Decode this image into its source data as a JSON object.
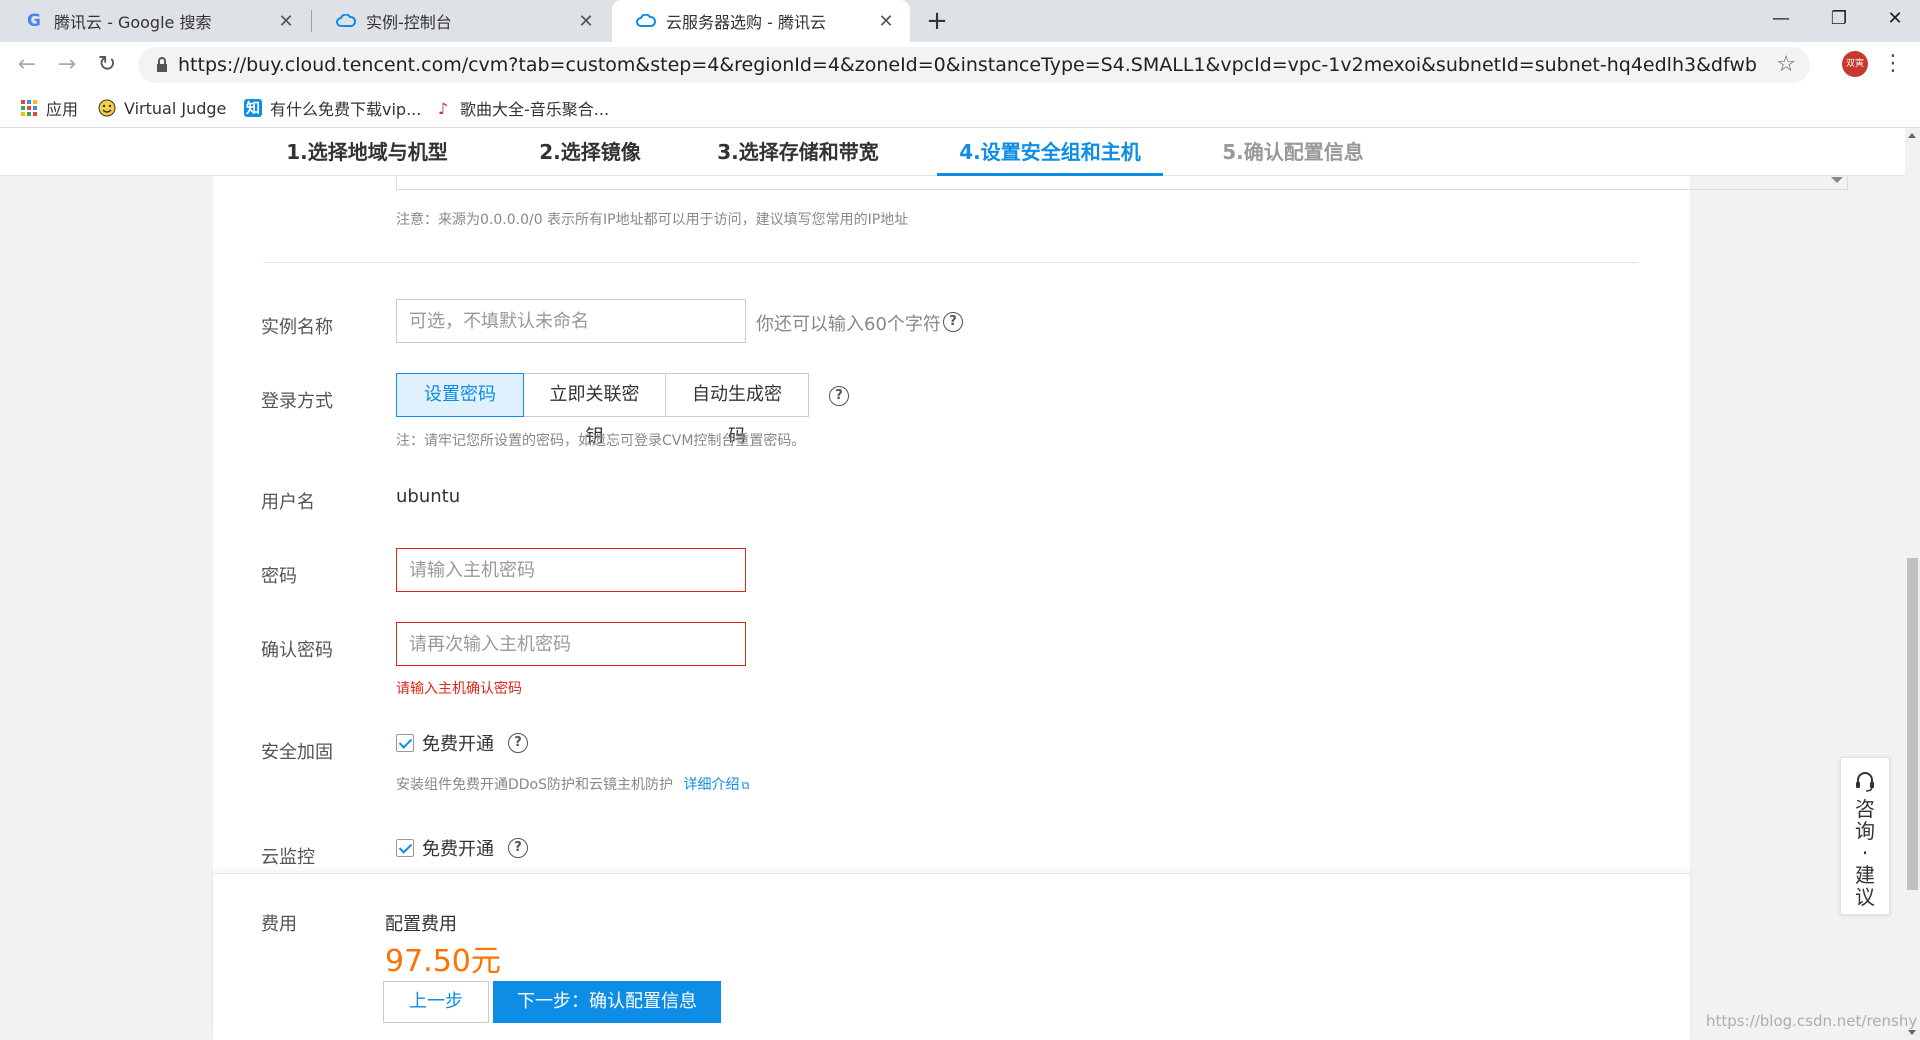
{
  "browser": {
    "tabs": [
      {
        "title": "腾讯云 - Google 搜索",
        "icon": "google-icon"
      },
      {
        "title": "实例-控制台",
        "icon": "cloud-icon"
      },
      {
        "title": "云服务器选购 - 腾讯云",
        "icon": "cloud-icon",
        "active": true
      }
    ],
    "url": "https://buy.cloud.tencent.com/cvm?tab=custom&step=4&regionId=4&zoneId=0&instanceType=S4.SMALL1&vpcId=vpc-1v2mexoi&subnetId=subnet-hq4edlh3&dfwbindType=add&platf...",
    "profile_label": "双寅",
    "bookmarks": [
      {
        "label": "应用",
        "icon": "apps-grid-icon"
      },
      {
        "label": "Virtual Judge",
        "icon": "smiley-icon"
      },
      {
        "label": "有什么免费下载vip...",
        "icon": "zhihu-icon",
        "icon_text": "知"
      },
      {
        "label": "歌曲大全-音乐聚合...",
        "icon": "music-note-icon"
      }
    ]
  },
  "steps": [
    {
      "label": "1.选择地域与机型"
    },
    {
      "label": "2.选择镜像"
    },
    {
      "label": "3.选择存储和带宽"
    },
    {
      "label": "4.设置安全组和主机",
      "active": true
    },
    {
      "label": "5.确认配置信息",
      "disabled": true
    }
  ],
  "form": {
    "source_note": "注意：来源为0.0.0.0/0 表示所有IP地址都可以用于访问，建议填写您常用的IP地址",
    "instance_name": {
      "label": "实例名称",
      "placeholder": "可选，不填默认未命名",
      "hint": "你还可以输入60个字符"
    },
    "login": {
      "label": "登录方式",
      "options": [
        "设置密码",
        "立即关联密钥",
        "自动生成密码"
      ],
      "selected": "设置密码",
      "note": "注：请牢记您所设置的密码，如遗忘可登录CVM控制台重置密码。"
    },
    "username": {
      "label": "用户名",
      "value": "ubuntu"
    },
    "password": {
      "label": "密码",
      "placeholder": "请输入主机密码"
    },
    "confirm_password": {
      "label": "确认密码",
      "placeholder": "请再次输入主机密码",
      "error": "请输入主机确认密码"
    },
    "security": {
      "label": "安全加固",
      "checkbox": "免费开通",
      "checked": true,
      "desc": "安装组件免费开通DDoS防护和云镜主机防护",
      "link": "详细介绍"
    },
    "monitor": {
      "label": "云监控",
      "checkbox": "免费开通",
      "checked": true
    }
  },
  "footer": {
    "fee_label": "费用",
    "config_fee_label": "配置费用",
    "price": "97.50元",
    "prev_button": "上一步",
    "next_button": "下一步：确认配置信息"
  },
  "consult": {
    "label": "咨询·建议"
  },
  "watermark": "https://blog.csdn.net/renshy",
  "colors": {
    "accent": "#0e8de6",
    "error": "#e1251b",
    "price": "#ff7200"
  }
}
